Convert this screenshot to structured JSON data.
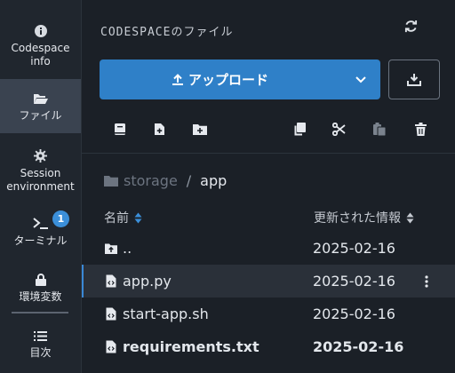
{
  "sidebar": {
    "items": [
      {
        "label": "Codespace\ninfo",
        "icon": "info-icon"
      },
      {
        "label": "ファイル",
        "icon": "folder-open-icon"
      },
      {
        "label": "Session\nenvironment",
        "icon": "gear-icon"
      },
      {
        "label": "ターミナル",
        "icon": "terminal-icon"
      },
      {
        "label": "環境変数",
        "icon": "lock-icon"
      },
      {
        "label": "目次",
        "icon": "list-icon"
      }
    ],
    "terminal_badge": "1"
  },
  "main": {
    "title": "CODESPACEのファイル",
    "upload_label": "アップロード",
    "breadcrumb": {
      "root": "storage",
      "separator": "/",
      "current": "app"
    },
    "columns": {
      "name": "名前",
      "date": "更新された情報"
    },
    "files": [
      {
        "name": "..",
        "date": "2025-02-16",
        "icon": "folder-up-icon"
      },
      {
        "name": "app.py",
        "date": "2025-02-16",
        "icon": "code-file-icon",
        "selected": true
      },
      {
        "name": "start-app.sh",
        "date": "2025-02-16",
        "icon": "code-file-icon"
      },
      {
        "name": "requirements.txt",
        "date": "2025-02-16",
        "icon": "code-file-icon",
        "bold": true
      }
    ]
  },
  "colors": {
    "accent": "#2f80c8",
    "sidebar_bg": "#20262e",
    "bg": "#1b2027",
    "selected_row": "#2a3039"
  }
}
